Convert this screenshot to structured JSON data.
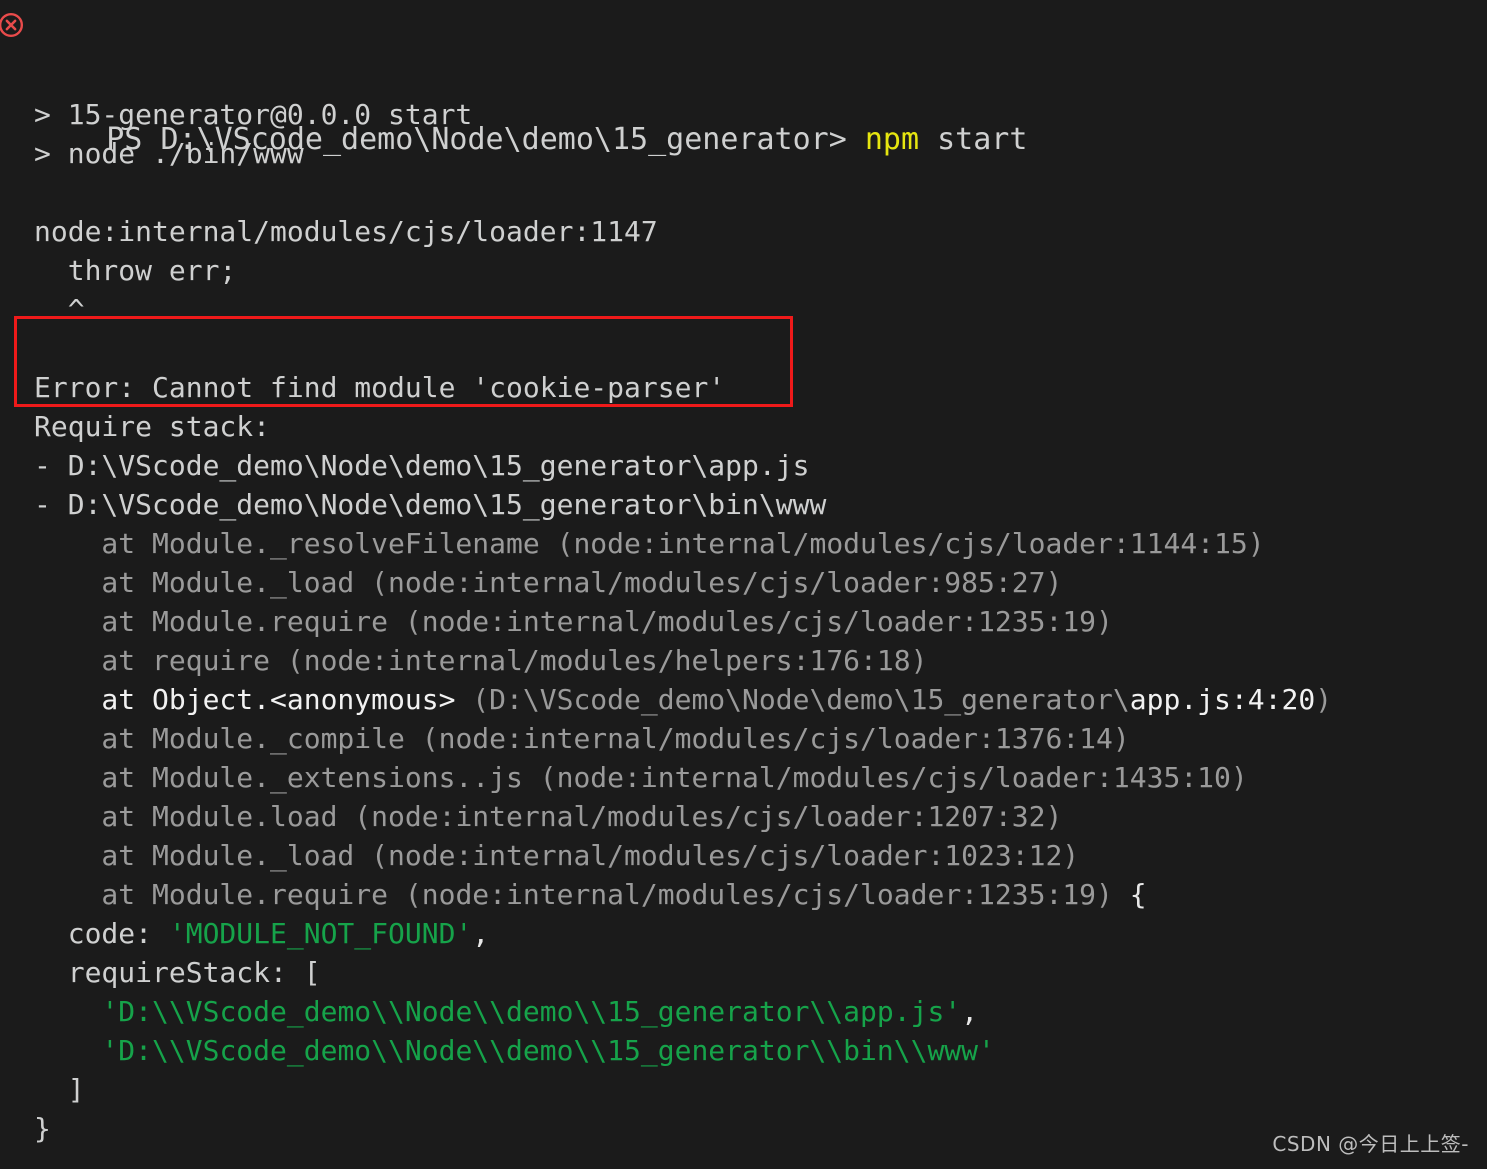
{
  "terminal": {
    "background_color": "#1b1b1b",
    "text_color": "#cfd0d0",
    "dim_color": "#9a9a9a",
    "string_color": "#16a34a",
    "command_color": "#e5e510",
    "annotation_color": "#ef1a1a",
    "status_icon": "error-circle-x-icon",
    "prompt": {
      "ps": "PS",
      "path": "D:\\VScode_demo\\Node\\demo\\15_generator>",
      "command_name": "npm",
      "command_args": "start"
    },
    "npm_header": {
      "line1": "> 15-generator@0.0.0 start",
      "line2": "> node ./bin/www"
    },
    "error_header": {
      "loader_line": "node:internal/modules/cjs/loader:1147",
      "throw_line": "  throw err;",
      "caret_line": "  ^"
    },
    "error_message": "Error: Cannot find module 'cookie-parser'",
    "require_stack_label": "Require stack:",
    "require_stack_paths": [
      "- D:\\VScode_demo\\Node\\demo\\15_generator\\app.js",
      "- D:\\VScode_demo\\Node\\demo\\15_generator\\bin\\www"
    ],
    "stack_frames": [
      {
        "fn": "    at Module._resolveFilename ",
        "loc": "(node:internal/modules/cjs/loader:1144:15)",
        "bright_fn": false,
        "highlight": "",
        "tail": ""
      },
      {
        "fn": "    at Module._load ",
        "loc": "(node:internal/modules/cjs/loader:985:27)",
        "bright_fn": false,
        "highlight": "",
        "tail": ""
      },
      {
        "fn": "    at Module.require ",
        "loc": "(node:internal/modules/cjs/loader:1235:19)",
        "bright_fn": false,
        "highlight": "",
        "tail": ""
      },
      {
        "fn": "    at require ",
        "loc": "(node:internal/modules/helpers:176:18)",
        "bright_fn": false,
        "highlight": "",
        "tail": ""
      },
      {
        "fn": "    at Object.<anonymous> ",
        "loc": "(D:\\VScode_demo\\Node\\demo\\15_generator\\",
        "bright_fn": true,
        "highlight": "app.js:4:20",
        "tail": ")"
      },
      {
        "fn": "    at Module._compile ",
        "loc": "(node:internal/modules/cjs/loader:1376:14)",
        "bright_fn": false,
        "highlight": "",
        "tail": ""
      },
      {
        "fn": "    at Module._extensions..js ",
        "loc": "(node:internal/modules/cjs/loader:1435:10)",
        "bright_fn": false,
        "highlight": "",
        "tail": ""
      },
      {
        "fn": "    at Module.load ",
        "loc": "(node:internal/modules/cjs/loader:1207:32)",
        "bright_fn": false,
        "highlight": "",
        "tail": ""
      },
      {
        "fn": "    at Module._load ",
        "loc": "(node:internal/modules/cjs/loader:1023:12)",
        "bright_fn": false,
        "highlight": "",
        "tail": ""
      },
      {
        "fn": "    at Module.require ",
        "loc": "(node:internal/modules/cjs/loader:1235:19)",
        "bright_fn": false,
        "highlight": "",
        "tail": " {"
      }
    ],
    "error_detail": {
      "code_label": "  code: ",
      "code_value": "'MODULE_NOT_FOUND'",
      "code_comma": ",",
      "require_stack_label": "  requireStack: [",
      "require_stack_values": [
        {
          "value": "'D:\\\\VScode_demo\\\\Node\\\\demo\\\\15_generator\\\\app.js'",
          "comma": ","
        },
        {
          "value": "'D:\\\\VScode_demo\\\\Node\\\\demo\\\\15_generator\\\\bin\\\\www'",
          "comma": ""
        }
      ],
      "close_bracket": "  ]",
      "close_brace": "}"
    }
  },
  "watermark": "CSDN @今日上上签-"
}
